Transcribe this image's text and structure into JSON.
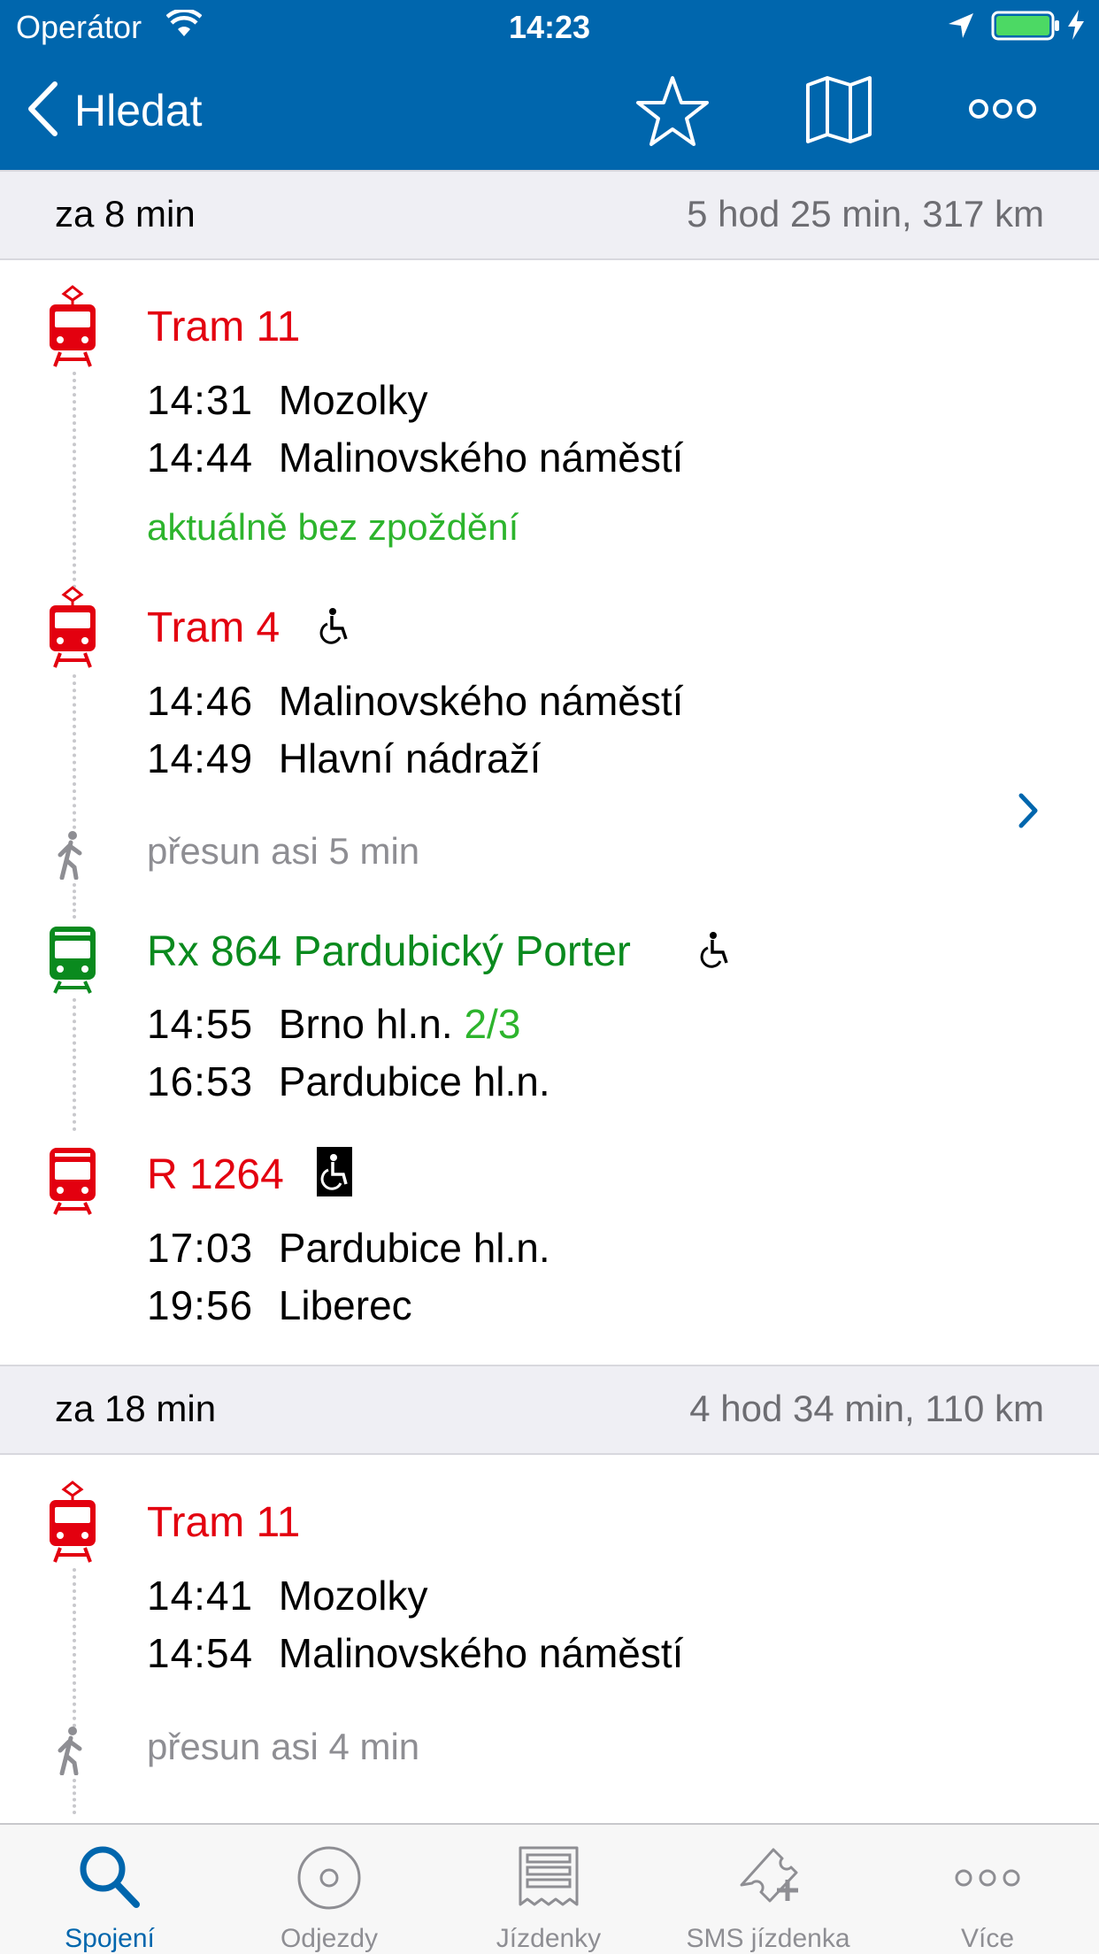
{
  "status_bar": {
    "carrier": "Operátor",
    "time": "14:23",
    "icons": [
      "wifi-icon",
      "location-arrow-icon",
      "battery-icon",
      "charging-bolt-icon"
    ]
  },
  "nav": {
    "back_label": "Hledat",
    "icons": [
      "chevron-left-icon",
      "star-icon",
      "map-icon",
      "more-icon"
    ]
  },
  "colors": {
    "header_bg": "#0066ad",
    "tram_red": "#e3000f",
    "train_green": "#0a8a1e",
    "delay_green": "#2db42d",
    "walk_gray": "#8e8e93",
    "section_bg": "#efeff4"
  },
  "connections": [
    {
      "when": "za 8 min",
      "summary": "5 hod 25 min, 317 km",
      "legs": [
        {
          "type": "tram",
          "name": "Tram 11",
          "stops": [
            {
              "time": "14:31",
              "station": "Mozolky"
            },
            {
              "time": "14:44",
              "station": "Malinovského náměstí"
            }
          ],
          "note": "aktuálně bez zpoždění"
        },
        {
          "type": "tram",
          "name": "Tram 4",
          "wheelchair": "outline",
          "stops": [
            {
              "time": "14:46",
              "station": "Malinovského náměstí"
            },
            {
              "time": "14:49",
              "station": "Hlavní nádraží"
            }
          ]
        },
        {
          "type": "walk",
          "label": "přesun asi 5 min"
        },
        {
          "type": "train",
          "name": "Rx 864 Pardubický Porter",
          "wheelchair": "outline",
          "stops": [
            {
              "time": "14:55",
              "station": "Brno hl.n.",
              "platform": "2/3"
            },
            {
              "time": "16:53",
              "station": "Pardubice hl.n."
            }
          ]
        },
        {
          "type": "train",
          "name": "R 1264",
          "wheelchair": "filled",
          "stops": [
            {
              "time": "17:03",
              "station": "Pardubice hl.n."
            },
            {
              "time": "19:56",
              "station": "Liberec"
            }
          ]
        }
      ]
    },
    {
      "when": "za 18 min",
      "summary": "4 hod 34 min, 110 km",
      "legs": [
        {
          "type": "tram",
          "name": "Tram 11",
          "stops": [
            {
              "time": "14:41",
              "station": "Mozolky"
            },
            {
              "time": "14:54",
              "station": "Malinovského náměstí"
            }
          ]
        },
        {
          "type": "walk",
          "label": "přesun asi 4 min"
        }
      ]
    }
  ],
  "tabs": [
    {
      "label": "Spojení",
      "icon": "search-icon",
      "active": true
    },
    {
      "label": "Odjezdy",
      "icon": "departures-icon",
      "active": false
    },
    {
      "label": "Jízdenky",
      "icon": "tickets-icon",
      "active": false
    },
    {
      "label": "SMS jízdenka",
      "icon": "sms-ticket-icon",
      "active": false
    },
    {
      "label": "Více",
      "icon": "more-icon",
      "active": false
    }
  ]
}
